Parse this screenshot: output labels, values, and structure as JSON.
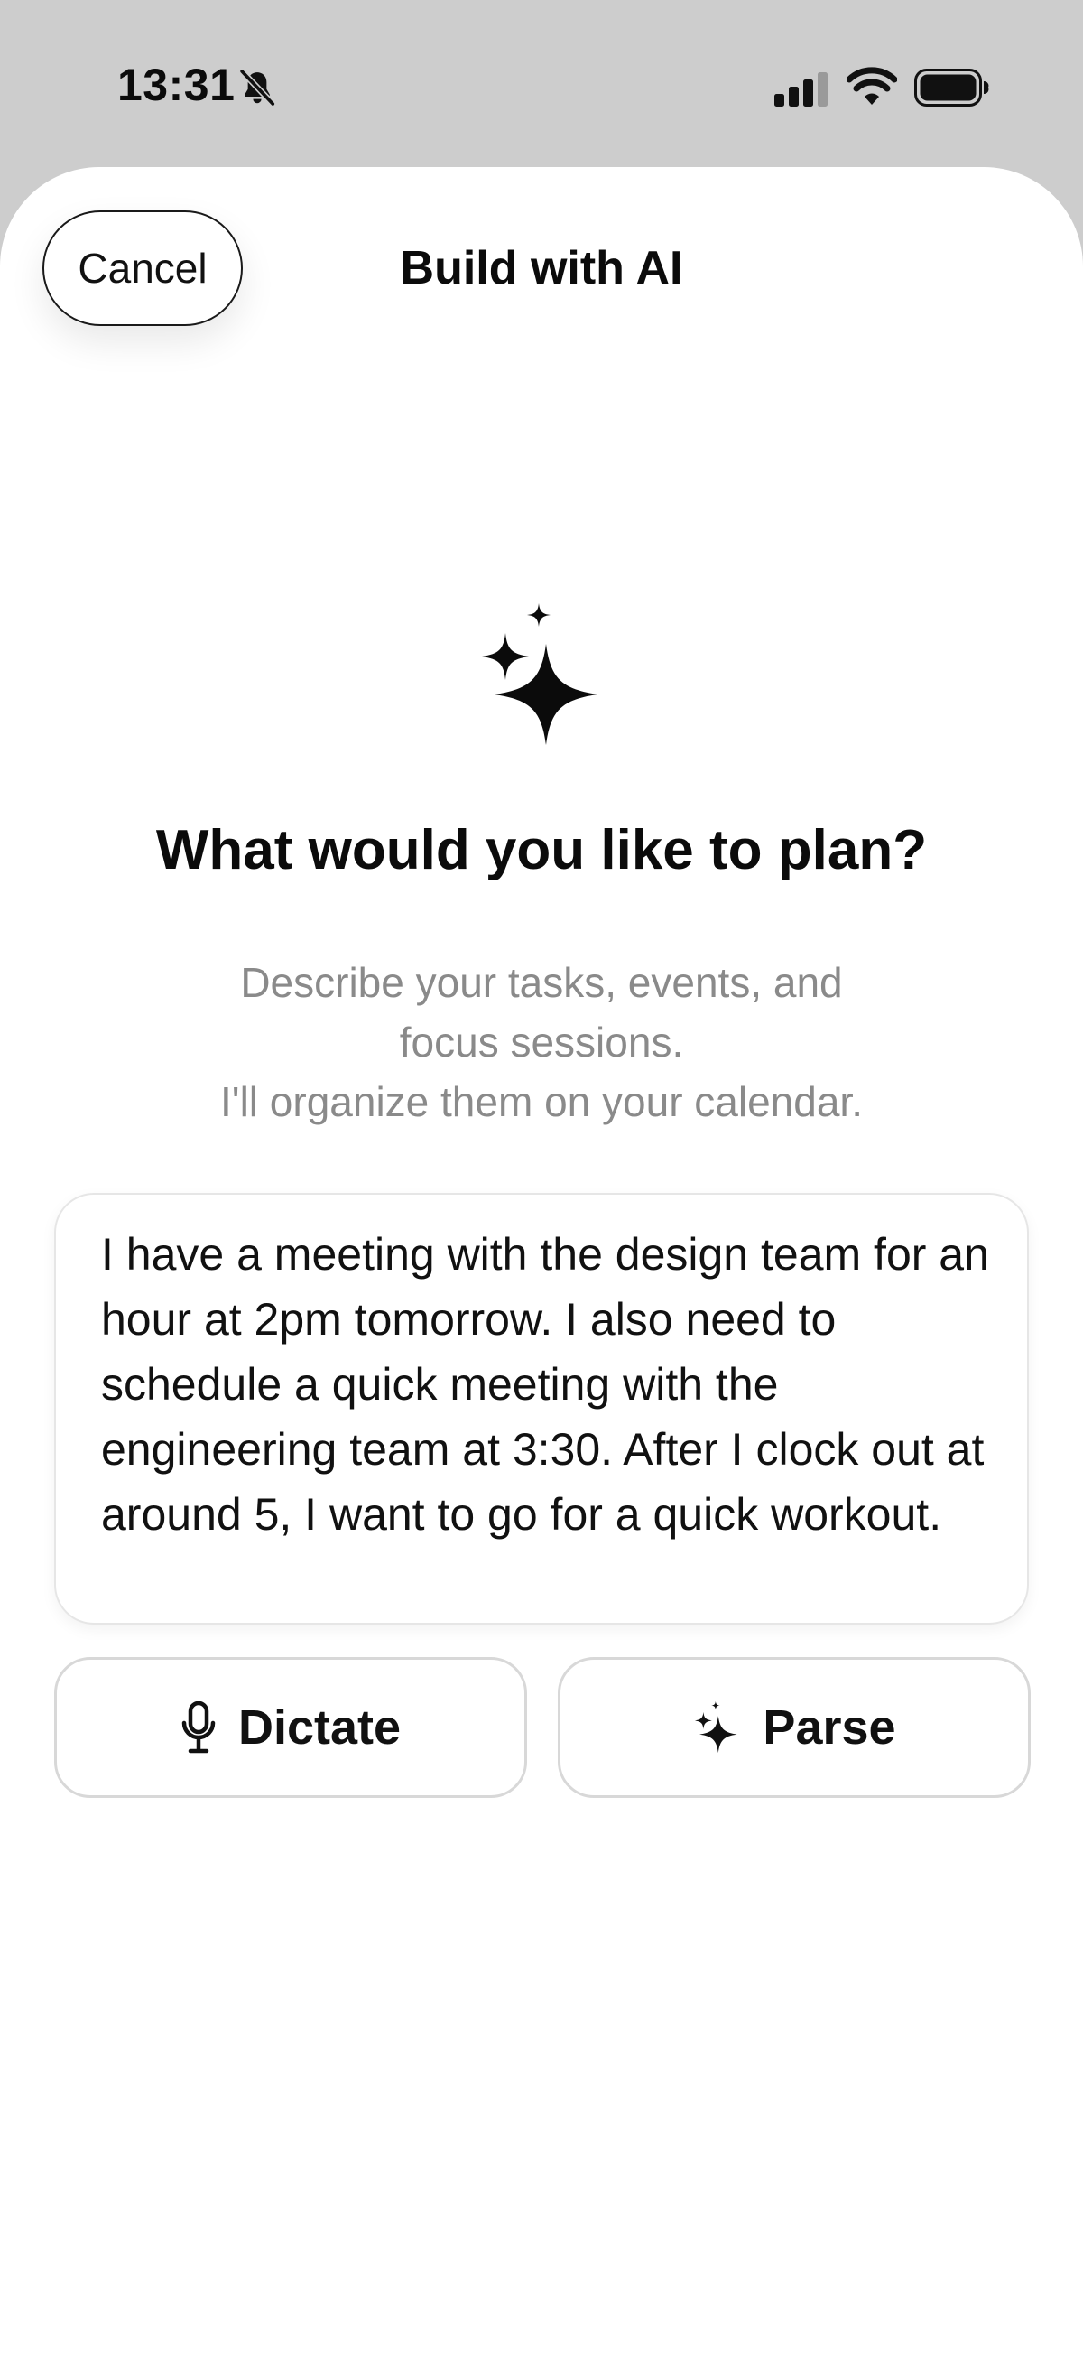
{
  "status_bar": {
    "time": "13:31",
    "icons": [
      "bell-slash-icon",
      "cellular-signal-icon",
      "wifi-icon",
      "battery-icon"
    ]
  },
  "header": {
    "cancel_label": "Cancel",
    "title": "Build with AI"
  },
  "hero": {
    "icon": "sparkles-icon",
    "headline": "What would you like to plan?",
    "subtitle_lines": [
      "Describe your tasks, events, and",
      "focus sessions.",
      "I'll organize them on your calendar."
    ]
  },
  "prompt": {
    "value": "I have a meeting with the design team for an hour at 2pm tomorrow. I also need to schedule a quick meeting with the engineering team at 3:30. After I clock out at around 5, I want to go for a quick workout."
  },
  "actions": {
    "dictate": {
      "label": "Dictate",
      "icon": "microphone-icon"
    },
    "parse": {
      "label": "Parse",
      "icon": "sparkles-icon"
    }
  },
  "colors": {
    "status_bar_background": "#cdcdcd",
    "sheet_background": "#ffffff",
    "text_primary": "#0b0b0b",
    "text_secondary": "#8a8a8a",
    "border": "#d8d8d8"
  }
}
